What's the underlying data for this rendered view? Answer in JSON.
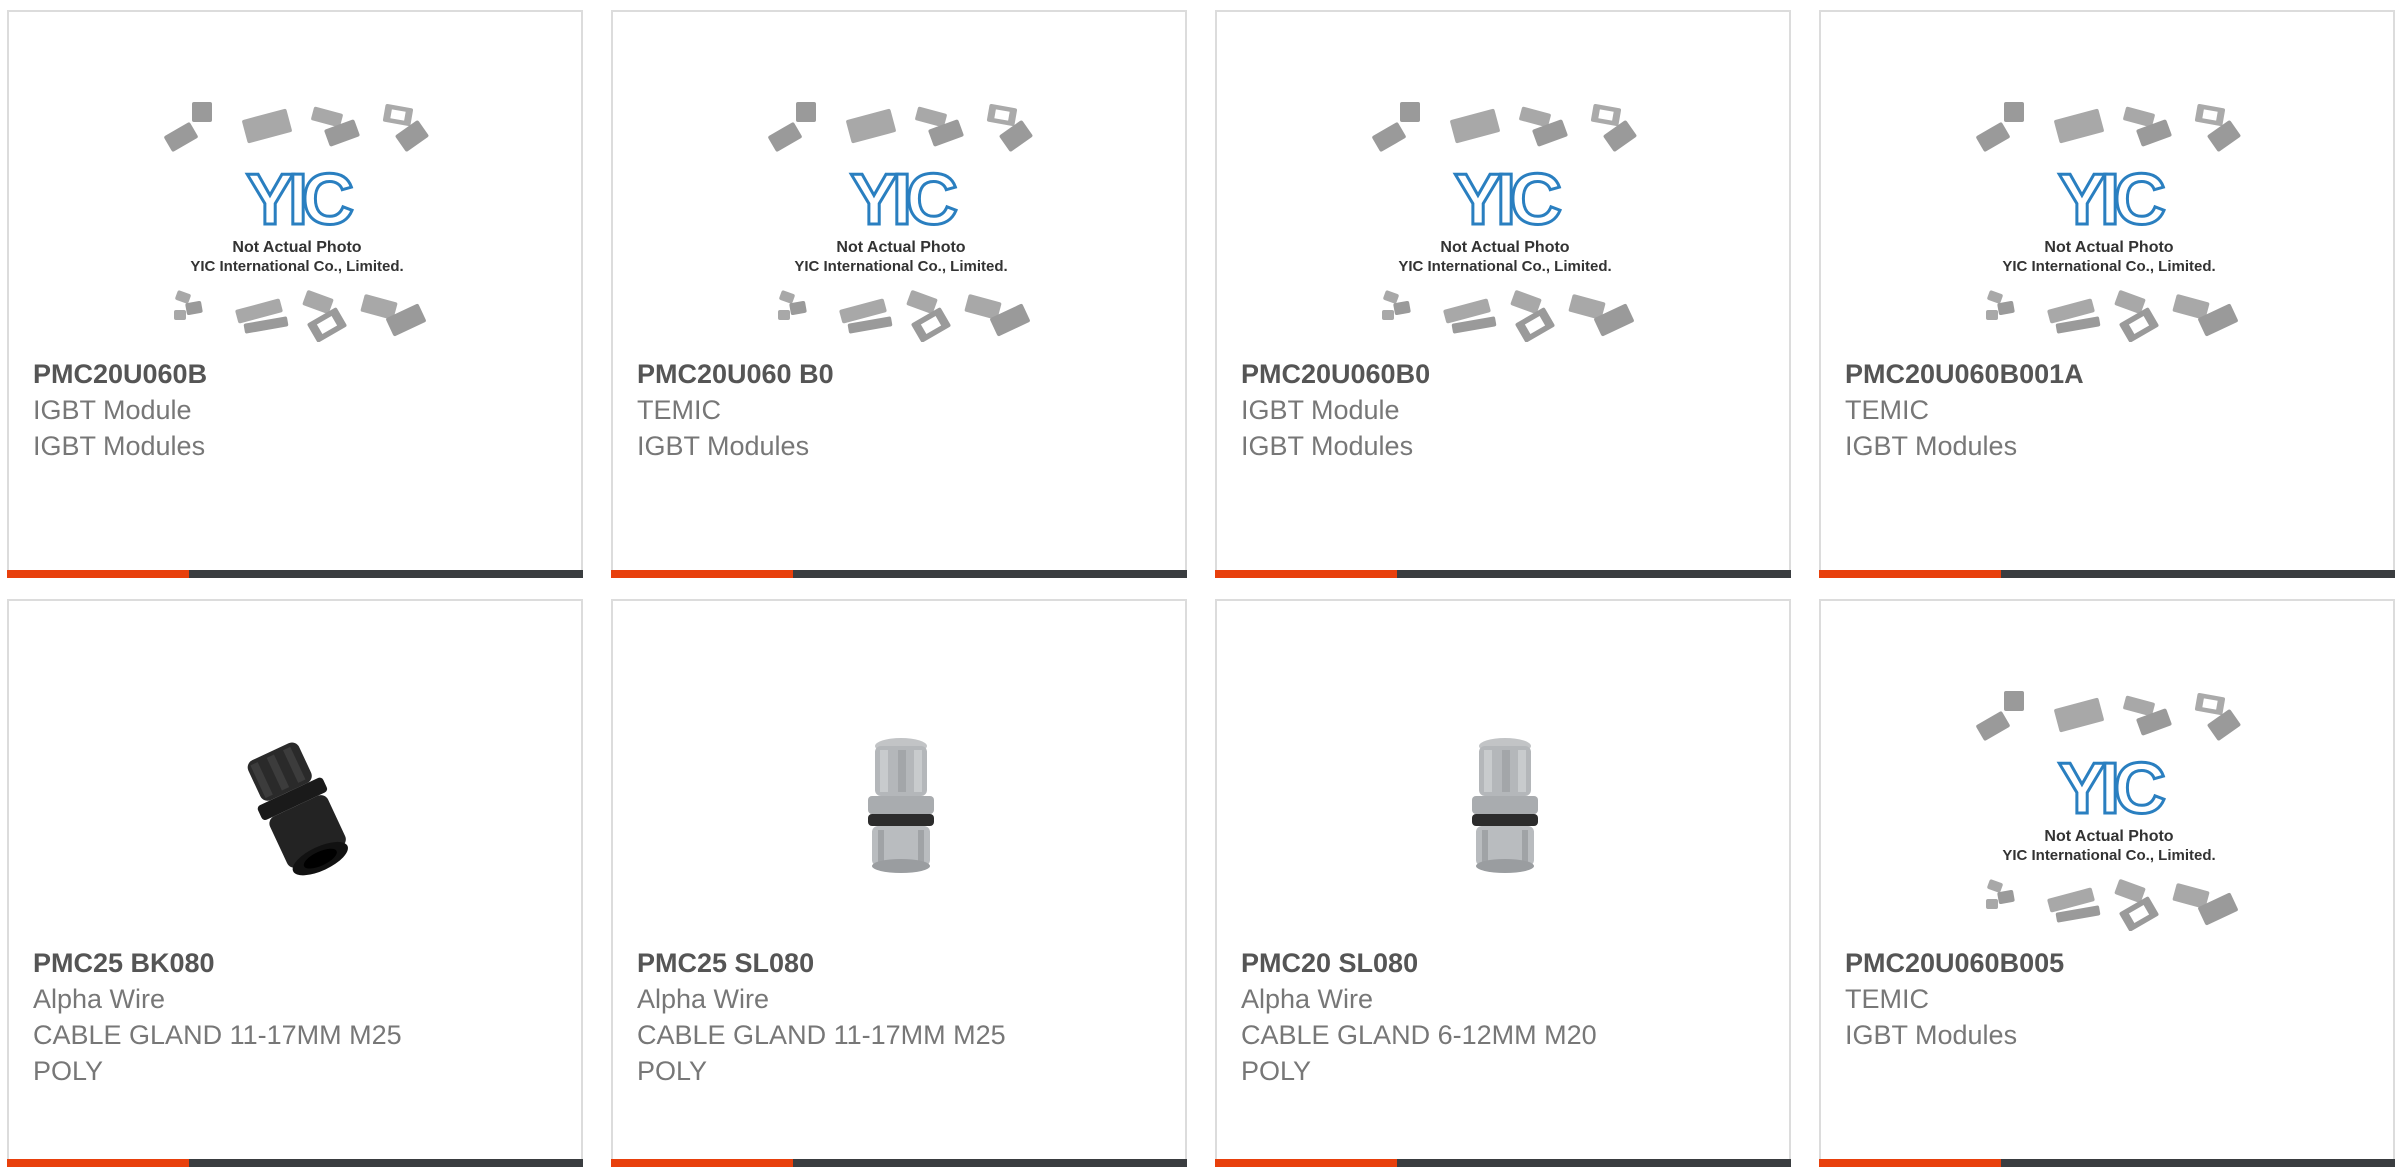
{
  "placeholder_image": {
    "logo_text": "YIC",
    "caption_line1": "Not Actual Photo",
    "caption_line2": "YIC International Co., Limited."
  },
  "products": [
    {
      "part": "PMC20U060B",
      "line1": "IGBT Module",
      "line2": "IGBT Modules",
      "line3": "",
      "image": "placeholder-photo"
    },
    {
      "part": "PMC20U060 B0",
      "line1": "TEMIC",
      "line2": "IGBT Modules",
      "line3": "",
      "image": "placeholder-photo"
    },
    {
      "part": "PMC20U060B0",
      "line1": "IGBT Module",
      "line2": "IGBT Modules",
      "line3": "",
      "image": "placeholder-photo"
    },
    {
      "part": "PMC20U060B001A",
      "line1": "TEMIC",
      "line2": "IGBT Modules",
      "line3": "",
      "image": "placeholder-photo"
    },
    {
      "part": "PMC25 BK080",
      "line1": "Alpha Wire",
      "line2": "CABLE GLAND 11-17MM M25",
      "line3": "POLY",
      "image": "black-cable-gland-photo"
    },
    {
      "part": "PMC25 SL080",
      "line1": "Alpha Wire",
      "line2": "CABLE GLAND 11-17MM M25",
      "line3": "POLY",
      "image": "grey-cable-gland-photo"
    },
    {
      "part": "PMC20 SL080",
      "line1": "Alpha Wire",
      "line2": "CABLE GLAND 6-12MM M20",
      "line3": "POLY",
      "image": "grey-cable-gland-photo"
    },
    {
      "part": "PMC20U060B005",
      "line1": "TEMIC",
      "line2": "IGBT Modules",
      "line3": "",
      "image": "placeholder-photo"
    }
  ],
  "colors": {
    "accent": "#e8400c",
    "bar": "#3a3d40",
    "border": "#dcdcdc",
    "part_text": "#555555",
    "body_text": "#777777",
    "logo_blue": "#2a7fc0"
  }
}
